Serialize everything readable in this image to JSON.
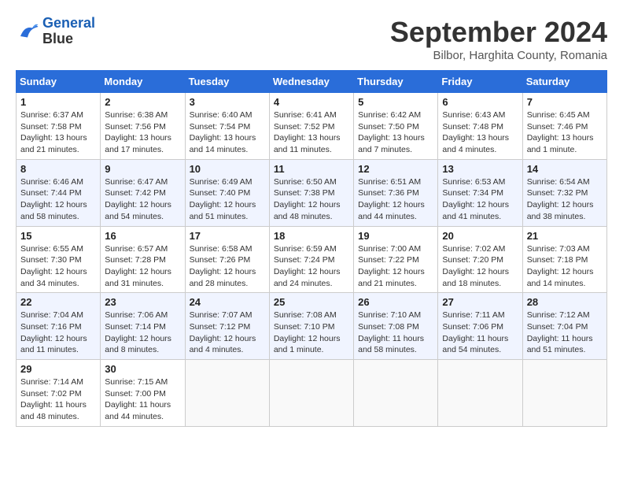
{
  "header": {
    "logo_line1": "General",
    "logo_line2": "Blue",
    "month": "September 2024",
    "location": "Bilbor, Harghita County, Romania"
  },
  "weekdays": [
    "Sunday",
    "Monday",
    "Tuesday",
    "Wednesday",
    "Thursday",
    "Friday",
    "Saturday"
  ],
  "weeks": [
    [
      {
        "day": "1",
        "sunrise": "6:37 AM",
        "sunset": "7:58 PM",
        "daylight": "13 hours and 21 minutes."
      },
      {
        "day": "2",
        "sunrise": "6:38 AM",
        "sunset": "7:56 PM",
        "daylight": "13 hours and 17 minutes."
      },
      {
        "day": "3",
        "sunrise": "6:40 AM",
        "sunset": "7:54 PM",
        "daylight": "13 hours and 14 minutes."
      },
      {
        "day": "4",
        "sunrise": "6:41 AM",
        "sunset": "7:52 PM",
        "daylight": "13 hours and 11 minutes."
      },
      {
        "day": "5",
        "sunrise": "6:42 AM",
        "sunset": "7:50 PM",
        "daylight": "13 hours and 7 minutes."
      },
      {
        "day": "6",
        "sunrise": "6:43 AM",
        "sunset": "7:48 PM",
        "daylight": "13 hours and 4 minutes."
      },
      {
        "day": "7",
        "sunrise": "6:45 AM",
        "sunset": "7:46 PM",
        "daylight": "13 hours and 1 minute."
      }
    ],
    [
      {
        "day": "8",
        "sunrise": "6:46 AM",
        "sunset": "7:44 PM",
        "daylight": "12 hours and 58 minutes."
      },
      {
        "day": "9",
        "sunrise": "6:47 AM",
        "sunset": "7:42 PM",
        "daylight": "12 hours and 54 minutes."
      },
      {
        "day": "10",
        "sunrise": "6:49 AM",
        "sunset": "7:40 PM",
        "daylight": "12 hours and 51 minutes."
      },
      {
        "day": "11",
        "sunrise": "6:50 AM",
        "sunset": "7:38 PM",
        "daylight": "12 hours and 48 minutes."
      },
      {
        "day": "12",
        "sunrise": "6:51 AM",
        "sunset": "7:36 PM",
        "daylight": "12 hours and 44 minutes."
      },
      {
        "day": "13",
        "sunrise": "6:53 AM",
        "sunset": "7:34 PM",
        "daylight": "12 hours and 41 minutes."
      },
      {
        "day": "14",
        "sunrise": "6:54 AM",
        "sunset": "7:32 PM",
        "daylight": "12 hours and 38 minutes."
      }
    ],
    [
      {
        "day": "15",
        "sunrise": "6:55 AM",
        "sunset": "7:30 PM",
        "daylight": "12 hours and 34 minutes."
      },
      {
        "day": "16",
        "sunrise": "6:57 AM",
        "sunset": "7:28 PM",
        "daylight": "12 hours and 31 minutes."
      },
      {
        "day": "17",
        "sunrise": "6:58 AM",
        "sunset": "7:26 PM",
        "daylight": "12 hours and 28 minutes."
      },
      {
        "day": "18",
        "sunrise": "6:59 AM",
        "sunset": "7:24 PM",
        "daylight": "12 hours and 24 minutes."
      },
      {
        "day": "19",
        "sunrise": "7:00 AM",
        "sunset": "7:22 PM",
        "daylight": "12 hours and 21 minutes."
      },
      {
        "day": "20",
        "sunrise": "7:02 AM",
        "sunset": "7:20 PM",
        "daylight": "12 hours and 18 minutes."
      },
      {
        "day": "21",
        "sunrise": "7:03 AM",
        "sunset": "7:18 PM",
        "daylight": "12 hours and 14 minutes."
      }
    ],
    [
      {
        "day": "22",
        "sunrise": "7:04 AM",
        "sunset": "7:16 PM",
        "daylight": "12 hours and 11 minutes."
      },
      {
        "day": "23",
        "sunrise": "7:06 AM",
        "sunset": "7:14 PM",
        "daylight": "12 hours and 8 minutes."
      },
      {
        "day": "24",
        "sunrise": "7:07 AM",
        "sunset": "7:12 PM",
        "daylight": "12 hours and 4 minutes."
      },
      {
        "day": "25",
        "sunrise": "7:08 AM",
        "sunset": "7:10 PM",
        "daylight": "12 hours and 1 minute."
      },
      {
        "day": "26",
        "sunrise": "7:10 AM",
        "sunset": "7:08 PM",
        "daylight": "11 hours and 58 minutes."
      },
      {
        "day": "27",
        "sunrise": "7:11 AM",
        "sunset": "7:06 PM",
        "daylight": "11 hours and 54 minutes."
      },
      {
        "day": "28",
        "sunrise": "7:12 AM",
        "sunset": "7:04 PM",
        "daylight": "11 hours and 51 minutes."
      }
    ],
    [
      {
        "day": "29",
        "sunrise": "7:14 AM",
        "sunset": "7:02 PM",
        "daylight": "11 hours and 48 minutes."
      },
      {
        "day": "30",
        "sunrise": "7:15 AM",
        "sunset": "7:00 PM",
        "daylight": "11 hours and 44 minutes."
      },
      null,
      null,
      null,
      null,
      null
    ]
  ]
}
